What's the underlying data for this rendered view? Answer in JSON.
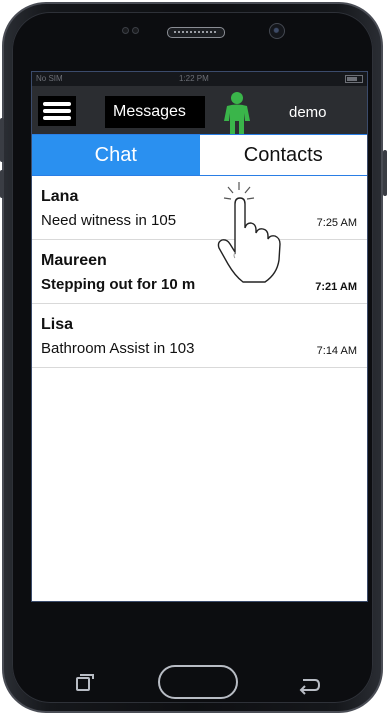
{
  "status_bar": {
    "carrier": "No SIM",
    "time": "1:22 PM"
  },
  "app_bar": {
    "title": "Messages",
    "user": "demo"
  },
  "tabs": [
    {
      "label": "Chat",
      "active": true
    },
    {
      "label": "Contacts",
      "active": false
    }
  ],
  "messages": [
    {
      "sender": "Lana",
      "preview": "Need witness in 105",
      "time": "7:25 AM",
      "unread": false
    },
    {
      "sender": "Maureen",
      "preview": "Stepping out for 10 m",
      "time": "7:21 AM",
      "unread": true
    },
    {
      "sender": "Lisa",
      "preview": "Bathroom Assist in 103",
      "time": "7:14 AM",
      "unread": false
    }
  ],
  "colors": {
    "accent": "#2a90f0",
    "appbar": "#2b2d31",
    "person_icon": "#3ab54a"
  },
  "icons": [
    "menu-icon",
    "person-icon",
    "tap-hand-icon",
    "recent-apps-icon",
    "home-button",
    "back-icon"
  ]
}
